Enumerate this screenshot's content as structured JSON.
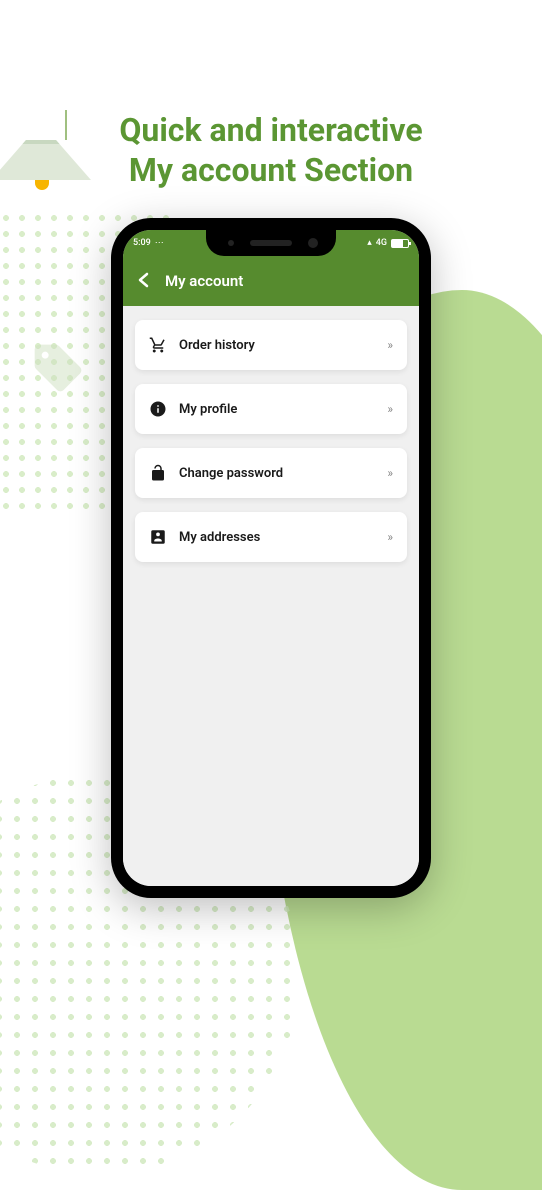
{
  "headline": {
    "line1": "Quick and interactive",
    "line2": "My account Section"
  },
  "statusbar": {
    "time": "5:09",
    "network": "4G"
  },
  "header": {
    "title": "My account"
  },
  "menu": {
    "items": [
      {
        "icon": "cart-icon",
        "label": "Order history"
      },
      {
        "icon": "info-icon",
        "label": "My profile"
      },
      {
        "icon": "lock-icon",
        "label": "Change password"
      },
      {
        "icon": "address-icon",
        "label": "My addresses"
      }
    ]
  },
  "colors": {
    "accent": "#568b2e",
    "headline": "#5b9633"
  }
}
